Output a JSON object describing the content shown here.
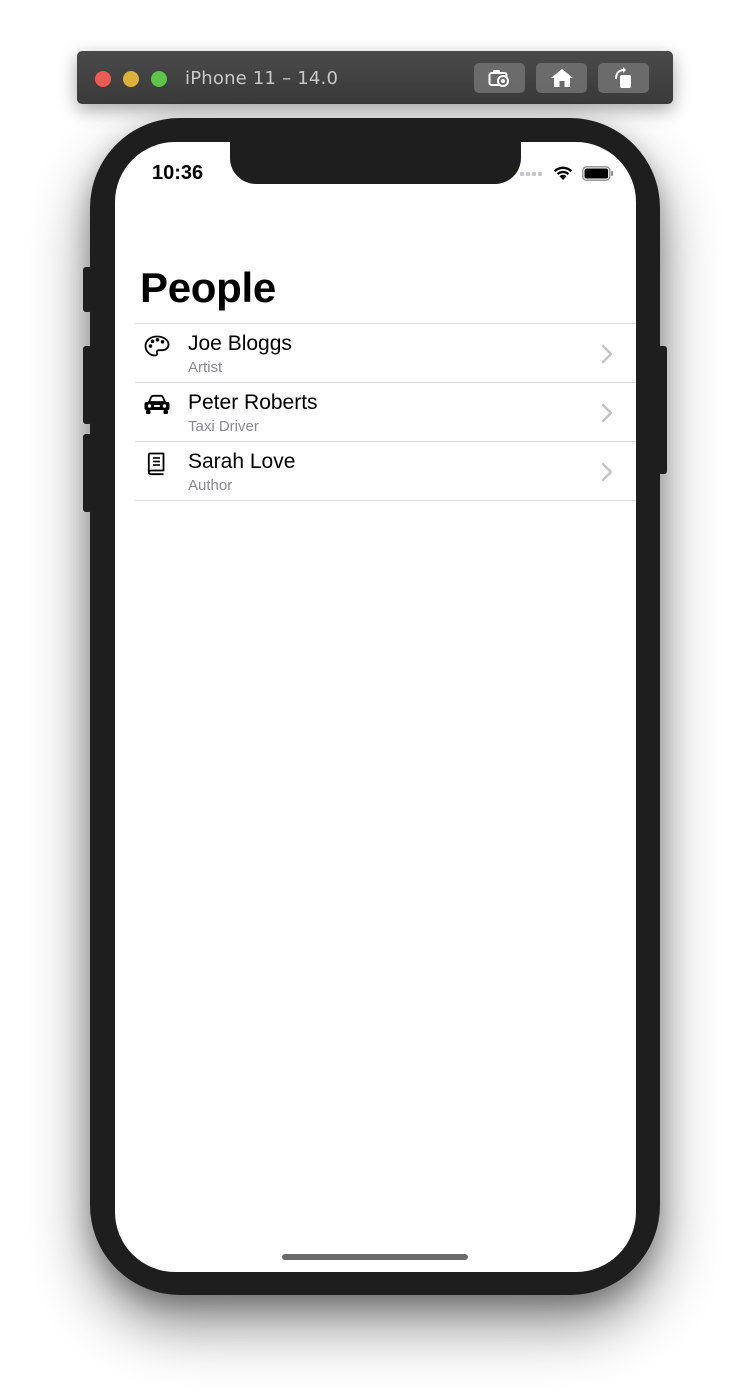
{
  "simulator": {
    "title": "iPhone 11 – 14.0",
    "buttons": [
      "screenshot-icon",
      "home-icon",
      "rotate-icon"
    ]
  },
  "status_bar": {
    "time": "10:36",
    "icons": [
      "cellular-signal-icon",
      "wifi-icon",
      "battery-icon"
    ]
  },
  "nav": {
    "title": "People"
  },
  "people": [
    {
      "name": "Joe Bloggs",
      "role": "Artist",
      "icon": "palette-icon"
    },
    {
      "name": "Peter Roberts",
      "role": "Taxi Driver",
      "icon": "car-icon"
    },
    {
      "name": "Sarah Love",
      "role": "Author",
      "icon": "book-icon"
    }
  ],
  "colors": {
    "simulator_bar": "#3f3f3f",
    "phone_frame": "#1e1e1e",
    "secondary_text": "#8a8a8e",
    "separator": "#dcdcdc",
    "chevron": "#c4c4c7"
  }
}
